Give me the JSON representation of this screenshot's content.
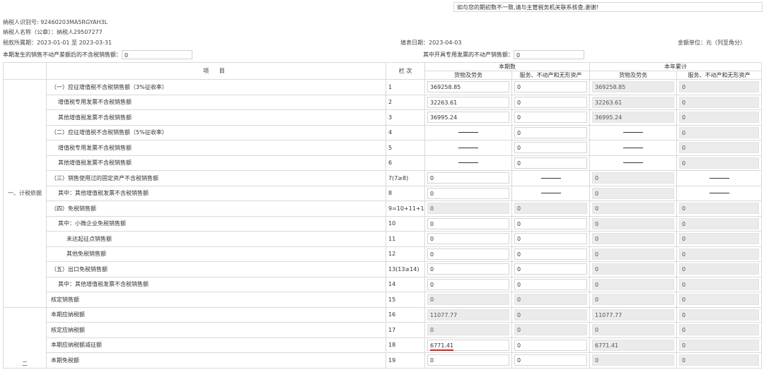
{
  "notice": "如与您的期初数不一致,请与主管税务机关联系核查,谢谢!",
  "taxpayer": {
    "id_line": "纳税人识别号: 92460203MA5RGYAH3L",
    "name_line": "纳税人名称（公章）：纳税人29507277",
    "period_line": "税款所属期：2023-01-01 至 2023-03-31",
    "fill_date": "填表日期：2023-04-03",
    "unit": "金额单位：元（列至角分）"
  },
  "top_fields": {
    "left_label": "本期发生的销售不动产差额后的不含税销售额：",
    "left_value": "0",
    "right_label": "其中开具专用发票的不动产销售额：",
    "right_value": "0"
  },
  "headers": {
    "item": "项 目",
    "col_no": "栏 次",
    "current": "本期数",
    "ytd": "本年累计",
    "goods": "货物及劳务",
    "services": "服务、不动产和无形资产"
  },
  "sections": {
    "one": "一、计税依据",
    "two": "二"
  },
  "dash_text": "——",
  "rows": [
    {
      "label": "（一）应征增值税不含税销售额（3%征收率）",
      "no": "1",
      "c1": "369258.85",
      "c2": "0",
      "c3": "369258.85",
      "c4": "0"
    },
    {
      "label": "增值税专用发票不含税销售额",
      "no": "2",
      "c1": "32263.61",
      "c2": "0",
      "c3": "32263.61",
      "c4": "0"
    },
    {
      "label": "其他增值税发票不含税销售额",
      "no": "3",
      "c1": "36995.24",
      "c2": "0",
      "c3": "36995.24",
      "c4": "0"
    },
    {
      "label": "（二）应征增值税不含税销售额（5%征收率）",
      "no": "4",
      "c2": "0",
      "c4": "0"
    },
    {
      "label": "增值税专用发票不含税销售额",
      "no": "5",
      "c2": "0",
      "c4": "0"
    },
    {
      "label": "其他增值税发票不含税销售额",
      "no": "6",
      "c2": "0",
      "c4": "0"
    },
    {
      "label": "（三）销售使用过的固定资产不含税销售额",
      "no": "7(7≥8)",
      "c1": "0",
      "c3": "0"
    },
    {
      "label": "其中：其他增值税发票不含税销售额",
      "no": "8",
      "c1": "0",
      "c3": "0"
    },
    {
      "label": "（四）免税销售额",
      "no": "9=10+11+12",
      "c1": "0",
      "c2": "0",
      "c3": "0",
      "c4": "0"
    },
    {
      "label": "其中：小微企业免税销售额",
      "no": "10",
      "c1": "0",
      "c2": "0",
      "c3": "0",
      "c4": "0"
    },
    {
      "label": "未达起征点销售额",
      "no": "11",
      "c1": "0",
      "c2": "0",
      "c3": "0",
      "c4": "0"
    },
    {
      "label": "其他免税销售额",
      "no": "12",
      "c1": "0",
      "c2": "0",
      "c3": "0",
      "c4": "0"
    },
    {
      "label": "（五）出口免税销售额",
      "no": "13(13≥14)",
      "c1": "0",
      "c2": "0",
      "c3": "0",
      "c4": "0"
    },
    {
      "label": "其中：其他增值税发票不含税销售额",
      "no": "14",
      "c1": "0",
      "c2": "0",
      "c3": "0",
      "c4": "0"
    },
    {
      "label": "核定销售额",
      "no": "15",
      "c1": "0",
      "c2": "0",
      "c3": "0",
      "c4": "0"
    },
    {
      "label": "本期应纳税额",
      "no": "16",
      "c1": "11077.77",
      "c2": "0",
      "c3": "11077.77",
      "c4": "0"
    },
    {
      "label": "核定应纳税额",
      "no": "17",
      "c1": "0",
      "c2": "0",
      "c3": "0",
      "c4": "0"
    },
    {
      "label": "本期应纳税额减征额",
      "no": "18",
      "c1": "6771.41",
      "c2": "0",
      "c3": "6771.41",
      "c4": "0"
    },
    {
      "label": "本期免税额",
      "no": "19",
      "c1": "0",
      "c2": "0",
      "c3": "0",
      "c4": "0"
    }
  ]
}
